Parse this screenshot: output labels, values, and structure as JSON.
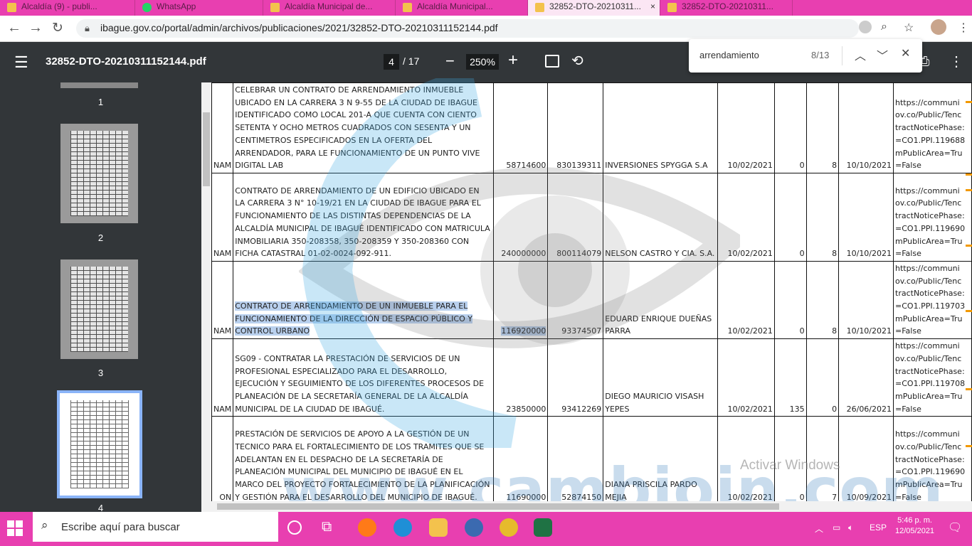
{
  "browser": {
    "tabs": [
      {
        "label": "Alcaldía (9) - publi..."
      },
      {
        "label": "WhatsApp"
      },
      {
        "label": "Alcaldía Municipal de..."
      },
      {
        "label": "Alcaldía Municipal..."
      },
      {
        "label": "32852-DTO-20210311..."
      },
      {
        "label": "32852-DTO-20210311..."
      }
    ],
    "url": "ibague.gov.co/portal/admin/archivos/publicaciones/2021/32852-DTO-20210311152144.pdf"
  },
  "pdf_toolbar": {
    "filename": "32852-DTO-20210311152144.pdf",
    "current_page": "4",
    "total_pages": "/ 17",
    "zoom": "250%"
  },
  "find_bar": {
    "query": "arrendamiento",
    "count": "8/13"
  },
  "thumbnails": [
    {
      "label": "1"
    },
    {
      "label": "2"
    },
    {
      "label": "3"
    },
    {
      "label": "4"
    }
  ],
  "table": {
    "rows": [
      {
        "c0": "NAM",
        "desc": "CELEBRAR UN CONTRATO DE ARRENDAMIENTO INMUEBLE UBICADO EN LA CARRERA 3 N 9-55 DE LA CIUDAD DE IBAGUE IDENTIFICADO COMO LOCAL 201-A QUE CUENTA CON CIENTO SETENTA Y OCHO METROS CUADRADOS CON SESENTA Y UN CENTIMETROS ESPECIFICADOS EN LA OFERTA DEL ARRENDADOR, PARA LE FUNCIONAMIENTO DE UN PUNTO VIVE DIGITAL LAB",
        "value": "58714600",
        "nit": "830139311",
        "contractor": "INVERSIONES SPYGGA S.A",
        "date": "10/02/2021",
        "n1": "0",
        "n2": "8",
        "end_date": "10/10/2021",
        "link": "https://communi\nov.co/Public/Tenc\ntractNoticePhase:\n=CO1.PPI.119688\nmPublicArea=Tru\n=False"
      },
      {
        "c0": "NAM",
        "desc": "CONTRATO DE ARRENDAMIENTO DE UN EDIFICIO UBICADO EN LA CARRERA 3 N° 10-19/21 EN LA CIUDAD DE IBAGUE PARA EL FUNCIONAMIENTO DE LAS DISTINTAS DEPENDENCIAS DE LA ALCALDÍA MUNICIPAL DE IBAGUÉ IDENTIFICADO CON MATRICULA INMOBILIARIA 350-208358, 350-208359 Y 350-208360 CON FICHA CATASTRAL 01-02-0024-092-911.",
        "value": "240000000",
        "nit": "800114079",
        "contractor": "NELSON CASTRO Y CIA. S.A.",
        "date": "10/02/2021",
        "n1": "0",
        "n2": "8",
        "end_date": "10/10/2021",
        "link": "https://communi\nov.co/Public/Tenc\ntractNoticePhase:\n=CO1.PPI.119690\nmPublicArea=Tru\n=False"
      },
      {
        "c0": "NAM",
        "desc": "CONTRATO DE ARRENDAMIENTO DE UN INMUEBLE PARA EL FUNCIONAMIENTO DE LA DIRECCIÓN DE ESPACIO PÚBLICO Y CONTROL URBANO",
        "value": "116920000",
        "nit": "93374507",
        "contractor": "EDUARD ENRIQUE DUEÑAS PARRA",
        "date": "10/02/2021",
        "n1": "0",
        "n2": "8",
        "end_date": "10/10/2021",
        "link": "https://communi\nov.co/Public/Tenc\ntractNoticePhase:\n=CO1.PPI.119703\nmPublicArea=Tru\n=False"
      },
      {
        "c0": "NAM",
        "desc": "SG09 - CONTRATAR LA PRESTACIÓN DE SERVICIOS DE UN PROFESIONAL ESPECIALIZADO PARA EL DESARROLLO, EJECUCIÓN Y SEGUIMIENTO DE LOS DIFERENTES PROCESOS DE PLANEACIÓN DE LA SECRETARÍA GENERAL DE LA ALCALDÍA MUNICIPAL DE LA CIUDAD DE IBAGUÉ.",
        "value": "23850000",
        "nit": "93412269",
        "contractor": "DIEGO MAURICIO VISASH YEPES",
        "date": "10/02/2021",
        "n1": "135",
        "n2": "0",
        "end_date": "26/06/2021",
        "link": "https://communi\nov.co/Public/Tenc\ntractNoticePhase:\n=CO1.PPI.119708\nmPublicArea=Tru\n=False"
      },
      {
        "c0": "ON",
        "desc": "PRESTACIÓN DE SERVICIOS DE APOYO A LA GESTIÓN DE UN TECNICO PARA EL FORTALECIMIENTO DE LOS TRAMITES QUE SE ADELANTAN EN EL DESPACHO DE LA SECRETARÍA DE PLANEACIÓN MUNICIPAL DEL MUNICIPIO DE IBAGUÉ EN EL MARCO DEL PROYECTO FORTALECIMIENTO DE LA PLANIFICACIÓN Y GESTIÓN PARA EL DESARROLLO DEL MUNICIPIO DE IBAGUÉ.",
        "value": "11690000",
        "nit": "52874150",
        "contractor": "DIANA PRISCILA PARDO MEJIA",
        "date": "10/02/2021",
        "n1": "0",
        "n2": "7",
        "end_date": "10/09/2021",
        "link": "https://communi\nov.co/Public/Tenc\ntractNoticePhase:\n=CO1.PPI.119690\nmPublicArea=Tru\n=False"
      }
    ]
  },
  "overlays": {
    "watermark": "www.cambioin.com",
    "activate_windows": "Activar Windows"
  },
  "taskbar": {
    "search_placeholder": "Escribe aquí para buscar",
    "language": "ESP",
    "time": "5:46 p. m.",
    "date": "12/05/2021"
  },
  "colors": {
    "accent": "#e83fb0",
    "pdf_toolbar": "#323639",
    "highlight": "#b9d0ee",
    "find_marker": "#f29900"
  }
}
